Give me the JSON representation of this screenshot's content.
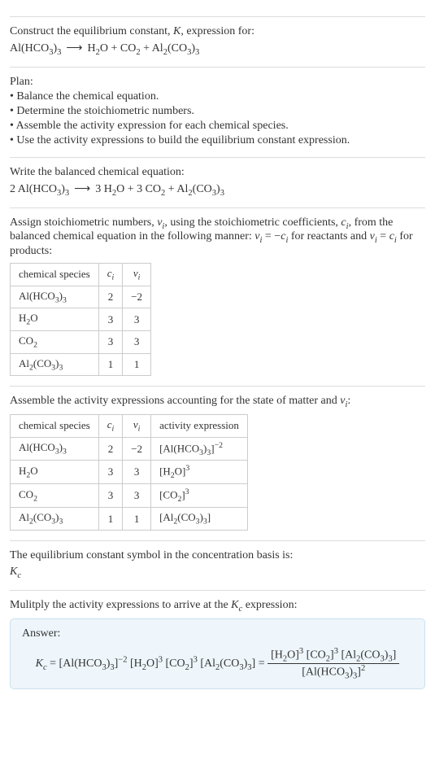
{
  "intro": {
    "line1": "Construct the equilibrium constant, K, expression for:",
    "equation": "Al(HCO3)3  ⟶  H2O + CO2 + Al2(CO3)3"
  },
  "plan": {
    "title": "Plan:",
    "items": [
      "• Balance the chemical equation.",
      "• Determine the stoichiometric numbers.",
      "• Assemble the activity expression for each chemical species.",
      "• Use the activity expressions to build the equilibrium constant expression."
    ]
  },
  "balanced": {
    "label": "Write the balanced chemical equation:",
    "equation": "2 Al(HCO3)3  ⟶  3 H2O + 3 CO2 + Al2(CO3)3"
  },
  "stoich": {
    "text": "Assign stoichiometric numbers, νi, using the stoichiometric coefficients, ci, from the balanced chemical equation in the following manner: νi = −ci for reactants and νi = ci for products:",
    "headers": [
      "chemical species",
      "ci",
      "νi"
    ],
    "rows": [
      [
        "Al(HCO3)3",
        "2",
        "−2"
      ],
      [
        "H2O",
        "3",
        "3"
      ],
      [
        "CO2",
        "3",
        "3"
      ],
      [
        "Al2(CO3)3",
        "1",
        "1"
      ]
    ]
  },
  "activity": {
    "text": "Assemble the activity expressions accounting for the state of matter and νi:",
    "headers": [
      "chemical species",
      "ci",
      "νi",
      "activity expression"
    ],
    "rows": [
      [
        "Al(HCO3)3",
        "2",
        "−2",
        "[Al(HCO3)3]^−2"
      ],
      [
        "H2O",
        "3",
        "3",
        "[H2O]^3"
      ],
      [
        "CO2",
        "3",
        "3",
        "[CO2]^3"
      ],
      [
        "Al2(CO3)3",
        "1",
        "1",
        "[Al2(CO3)3]"
      ]
    ]
  },
  "symbol": {
    "text": "The equilibrium constant symbol in the concentration basis is:",
    "value": "Kc"
  },
  "multiply": {
    "text": "Mulitply the activity expressions to arrive at the Kc expression:"
  },
  "answer": {
    "label": "Answer:",
    "lhs": "Kc = [Al(HCO3)3]^−2 [H2O]^3 [CO2]^3 [Al2(CO3)3] =",
    "num": "[H2O]^3 [CO2]^3 [Al2(CO3)3]",
    "den": "[Al(HCO3)3]^2"
  }
}
